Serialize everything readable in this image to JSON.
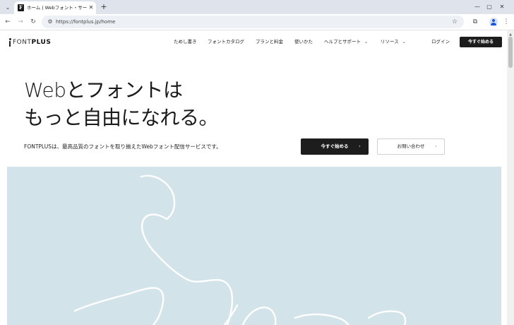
{
  "browser": {
    "tab_list_icon": "chevron-down-icon",
    "tab": {
      "favicon_letter": "F",
      "title": "ホーム | Webフォント・サービス FONTPLUS",
      "close_icon": "close-icon"
    },
    "new_tab_icon": "plus-icon",
    "window_controls": [
      "minimize-icon",
      "maximize-icon",
      "close-icon"
    ],
    "address_bar": {
      "url": "https://fontplus.jp/home"
    }
  },
  "site": {
    "logo": {
      "part1": "FONT",
      "part2": "PLUS"
    },
    "nav": [
      {
        "label": "ためし書き",
        "has_dropdown": false
      },
      {
        "label": "フォントカタログ",
        "has_dropdown": false
      },
      {
        "label": "プランと料金",
        "has_dropdown": false
      },
      {
        "label": "使いかた",
        "has_dropdown": false
      },
      {
        "label": "ヘルプとサポート",
        "has_dropdown": true
      },
      {
        "label": "リソース",
        "has_dropdown": true
      }
    ],
    "login_label": "ログイン",
    "header_cta_label": "今すぐ始める"
  },
  "hero": {
    "headline_line1": "Webとフォントは",
    "headline_line2": "もっと自由になれる。",
    "description": "FONTPLUSは、最高品質のフォントを取り揃えたWebフォント配信サービスです。",
    "primary_cta": "今すぐ始める",
    "secondary_cta": "お問い合わせ",
    "arrow_glyph": "›"
  },
  "colors": {
    "hero_visual_bg": "#d2e3ea",
    "button_dark": "#1d1d1d",
    "tabbar_bg": "#dfe3eb"
  }
}
